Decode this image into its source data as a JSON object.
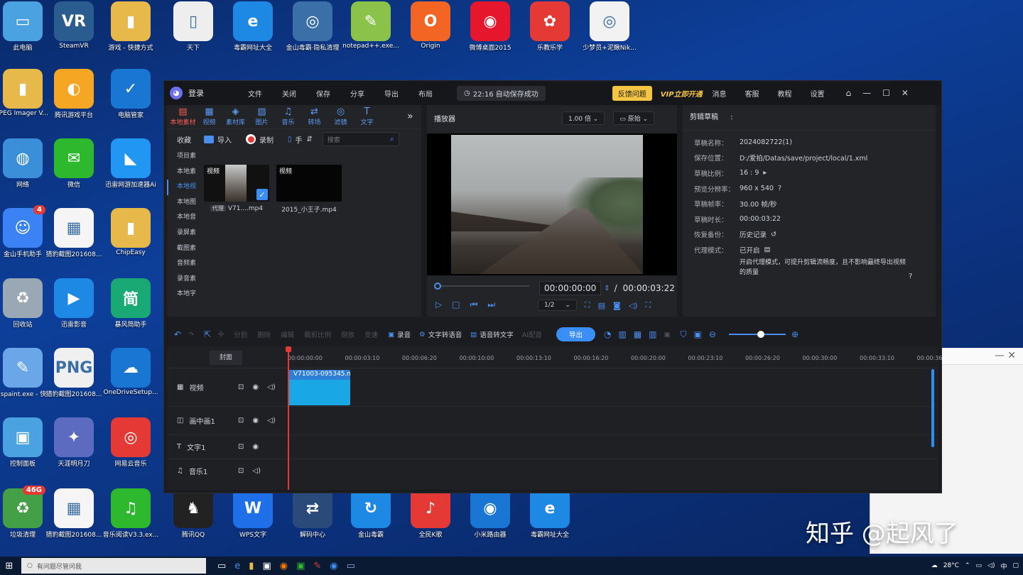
{
  "desktop": {
    "icons": [
      {
        "label": "此电脑",
        "glyph": "▭",
        "color": "#4aa3e0"
      },
      {
        "label": "SteamVR",
        "glyph": "VR",
        "color": "#2b5c8f"
      },
      {
        "label": "游戏 - 快捷方式",
        "glyph": "▮",
        "color": "#e7b94a"
      },
      {
        "label": "天下",
        "glyph": "▯",
        "color": "#eeeeee"
      },
      {
        "label": "毒霸网址大全",
        "glyph": "e",
        "color": "#1e88e5"
      },
      {
        "label": "金山毒霸·隐私清理",
        "glyph": "◎",
        "color": "#3b6fa8"
      },
      {
        "label": "notepad++.exe...",
        "glyph": "✎",
        "color": "#8bc34a"
      },
      {
        "label": "Origin",
        "glyph": "O",
        "color": "#f26522"
      },
      {
        "label": "微博桌面2015",
        "glyph": "◉",
        "color": "#e6162d"
      },
      {
        "label": "乐教乐学",
        "glyph": "✿",
        "color": "#e53935"
      },
      {
        "label": "少梦员+泥鳅Nik...",
        "glyph": "◎",
        "color": "#f2f2f2"
      },
      {
        "label": "JPEG Imager V...",
        "glyph": "▮",
        "color": "#e7b94a"
      },
      {
        "label": "腾讯游戏平台",
        "glyph": "◐",
        "color": "#f5a623"
      },
      {
        "label": "电脑管家",
        "glyph": "✓",
        "color": "#1976d2"
      },
      {
        "label": "网络",
        "glyph": "◍",
        "color": "#3a8fd8"
      },
      {
        "label": "微信",
        "glyph": "✉",
        "color": "#2eb82e"
      },
      {
        "label": "迅雷网游加速器Ai",
        "glyph": "◣",
        "color": "#2196f3"
      },
      {
        "label": "金山手机助手",
        "glyph": "☺",
        "color": "#3b82f6",
        "badge": "4"
      },
      {
        "label": "猎豹截图201608...",
        "glyph": "▦",
        "color": "#f5f5f5"
      },
      {
        "label": "ChipEasy",
        "glyph": "▮",
        "color": "#e7b94a"
      },
      {
        "label": "回收站",
        "glyph": "♻",
        "color": "#9aa7b5"
      },
      {
        "label": "迅雷影音",
        "glyph": "▶",
        "color": "#1e88e5"
      },
      {
        "label": "暴风简助手",
        "glyph": "简",
        "color": "#19a974"
      },
      {
        "label": "mspaint.exe - 快...",
        "glyph": "✎",
        "color": "#6aa6e8"
      },
      {
        "label": "猎豹截图201608...",
        "glyph": "PNG",
        "color": "#f0f0f0"
      },
      {
        "label": "OneDriveSetup...",
        "glyph": "☁",
        "color": "#1976d2"
      },
      {
        "label": "控制面板",
        "glyph": "▣",
        "color": "#4aa3e0"
      },
      {
        "label": "天涯明月刀",
        "glyph": "✦",
        "color": "#5c6bc0"
      },
      {
        "label": "网易云音乐",
        "glyph": "◎",
        "color": "#e53935"
      },
      {
        "label": "垃圾清理",
        "glyph": "♻",
        "color": "#43a047",
        "badge": "46G"
      },
      {
        "label": "猎豹截图201608...",
        "glyph": "▦",
        "color": "#f5f5f5"
      },
      {
        "label": "音乐阅读V3.3.ex...",
        "glyph": "♫",
        "color": "#2eb82e"
      },
      {
        "label": "腾讯QQ",
        "glyph": "♞",
        "color": "#222222"
      },
      {
        "label": "WPS文字",
        "glyph": "W",
        "color": "#1e6fe8"
      },
      {
        "label": "解码中心",
        "glyph": "⇄",
        "color": "#2a4a7a"
      },
      {
        "label": "金山毒霸",
        "glyph": "↻",
        "color": "#1e88e5"
      },
      {
        "label": "全民K歌",
        "glyph": "♪",
        "color": "#e53935"
      },
      {
        "label": "小米路由器",
        "glyph": "◉",
        "color": "#1976d2"
      },
      {
        "label": "毒霸网址大全",
        "glyph": "e",
        "color": "#1e88e5"
      }
    ]
  },
  "editor": {
    "login": "登录",
    "logo_glyph": "◕",
    "menu": [
      "文件",
      "关闭",
      "保存",
      "分享",
      "导出",
      "布局"
    ],
    "autosave": "22:16 自动保存成功",
    "feedback": "反馈问题",
    "vip": "VIP立即开通",
    "right_menu": [
      "消息",
      "客服",
      "教程",
      "设置"
    ],
    "home_icon": "⌂",
    "win_controls": [
      "—",
      "☐",
      "✕"
    ],
    "tabs": [
      {
        "label": "本地素材",
        "glyph": "▤",
        "active": true
      },
      {
        "label": "视频",
        "glyph": "▦"
      },
      {
        "label": "素材库",
        "glyph": "◈"
      },
      {
        "label": "图片",
        "glyph": "▨"
      },
      {
        "label": "音乐",
        "glyph": "♫"
      },
      {
        "label": "转场",
        "glyph": "⇄"
      },
      {
        "label": "滤镜",
        "glyph": "◎"
      },
      {
        "label": "文字",
        "glyph": "T"
      }
    ],
    "more_icon": "»",
    "sub": {
      "collect": "收藏",
      "import": "导入",
      "record": "录制",
      "hand": "手",
      "sort_icon": "⇵",
      "search_placeholder": "搜索"
    },
    "categories": [
      "项目素",
      "本地素",
      "本地视",
      "本地图",
      "本地音",
      "录屏素",
      "截图素",
      "音频素",
      "录音素",
      "本地字"
    ],
    "media": [
      {
        "tag": "视频",
        "caption": "V71....mp4",
        "proxy": "代理",
        "checked": true
      },
      {
        "tag": "视频",
        "caption": "2015_小王子.mp4"
      }
    ],
    "player": {
      "title": "播放器",
      "speed": "1.00 倍",
      "ratio": "原始",
      "current_time": "00:00:00:00",
      "separator": "/",
      "total_time": "00:00:03:22",
      "quality": "1/2",
      "progress": 0
    },
    "draft": {
      "title": "剪辑草稿",
      "colon": ":",
      "rows": [
        {
          "k": "草稿名称：",
          "v": "2024082722(1)"
        },
        {
          "k": "保存位置：",
          "v": "D:/爱拍/Datas/save/project/local/1.xml"
        },
        {
          "k": "草稿比例：",
          "v": "16 : 9"
        },
        {
          "k": "预览分辨率：",
          "v": "960 x 540"
        },
        {
          "k": "草稿帧率：",
          "v": "30.00 帧/秒"
        },
        {
          "k": "草稿时长：",
          "v": "00:00:03:22"
        },
        {
          "k": "恢复备份：",
          "v": "历史记录"
        },
        {
          "k": "代理模式：",
          "v": "已开启"
        }
      ],
      "proxy_desc": "开启代理模式，可提升剪辑流畅度，且不影响最终导出视频的质量"
    },
    "toolbar": {
      "dim_items": [
        "分割",
        "删除",
        "编辑",
        "裁剪比例",
        "倒放",
        "变速"
      ],
      "record": "录音",
      "tts": "文字转语音",
      "stt": "语音转文字",
      "dim_fx": "AI配音",
      "export": "导出"
    },
    "timeline": {
      "cover": "封面",
      "ruler": [
        "00:00:00:00",
        "00:00:03:10",
        "00:00:06:20",
        "00:00:10:00",
        "00:00:13:10",
        "00:00:16:20",
        "00:00:20:00",
        "00:00:23:10",
        "00:00:26:20",
        "00:00:30:00",
        "00:00:33:10",
        "00:00:36"
      ],
      "tracks": [
        {
          "name": "视频",
          "glyph": "▦",
          "ctls": [
            "🔒",
            "◉",
            "◁)"
          ]
        },
        {
          "name": "画中画1",
          "glyph": "◫",
          "ctls": [
            "🔒",
            "◉",
            "◁)"
          ]
        },
        {
          "name": "文字1",
          "glyph": "T",
          "ctls": [
            "🔒",
            "◉"
          ]
        },
        {
          "name": "音乐1",
          "glyph": "♫",
          "ctls": [
            "🔒",
            "◁)"
          ]
        }
      ],
      "clip_label": "V71003-095345.m"
    }
  },
  "watermark": "知乎 @起风了",
  "taskbar": {
    "search_placeholder": "有问题尽管问我",
    "weather": "28°C",
    "ime": "中"
  }
}
